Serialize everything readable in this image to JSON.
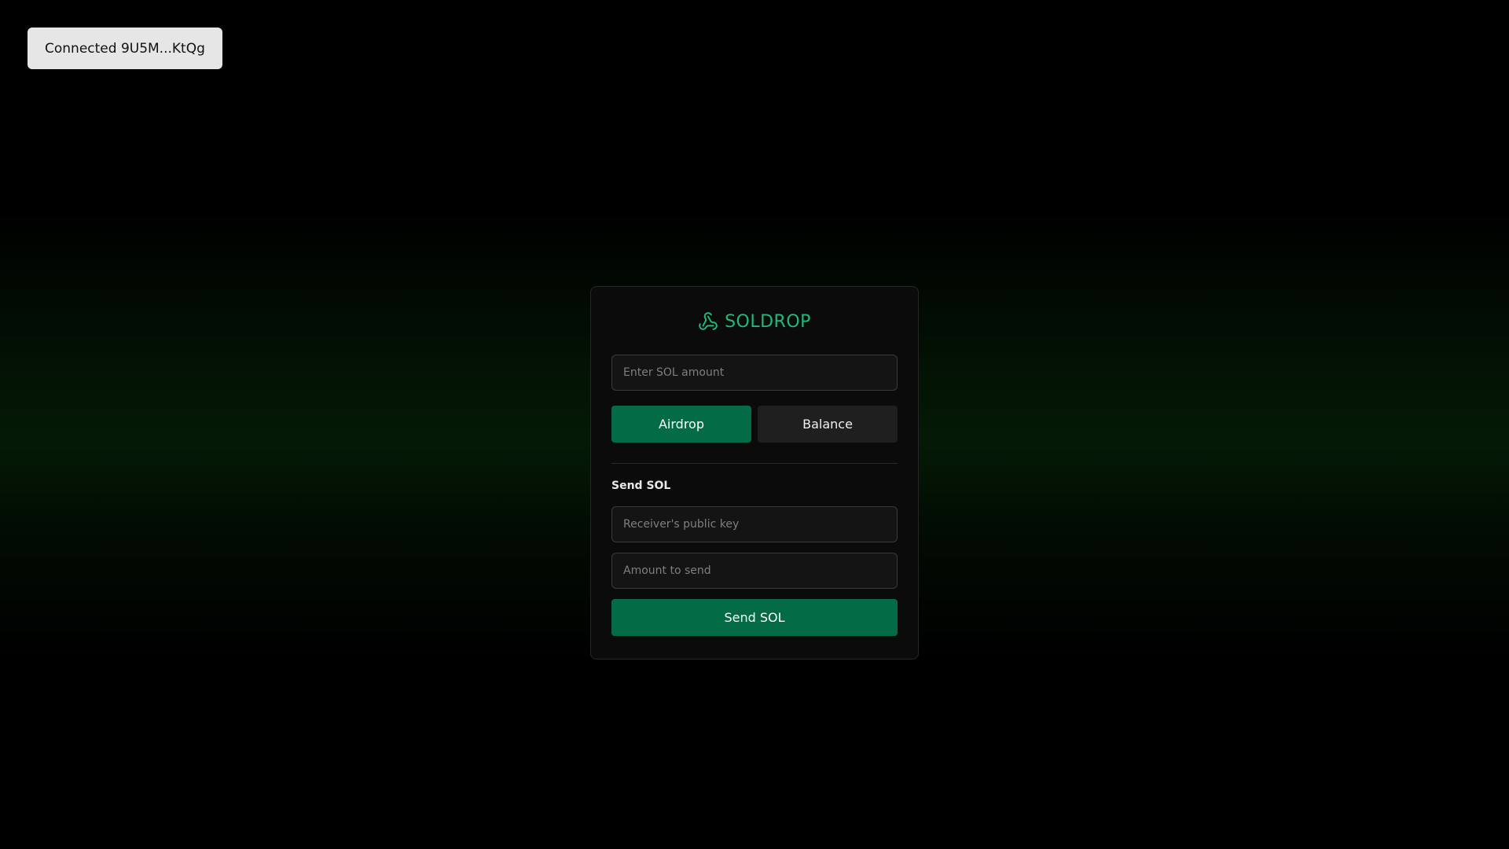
{
  "wallet": {
    "connected_label": "Connected 9U5M...KtQg"
  },
  "brand": {
    "name": "SOLDROP",
    "icon": "webhook-icon",
    "accent_color": "#22b87a"
  },
  "airdrop": {
    "amount_placeholder": "Enter SOL amount",
    "airdrop_label": "Airdrop",
    "balance_label": "Balance"
  },
  "send": {
    "title": "Send SOL",
    "receiver_placeholder": "Receiver's public key",
    "amount_placeholder": "Amount to send",
    "send_label": "Send SOL"
  },
  "colors": {
    "primary_button": "#036b46",
    "secondary_button": "#1f1f1f",
    "card_background": "#0b0b0b"
  }
}
